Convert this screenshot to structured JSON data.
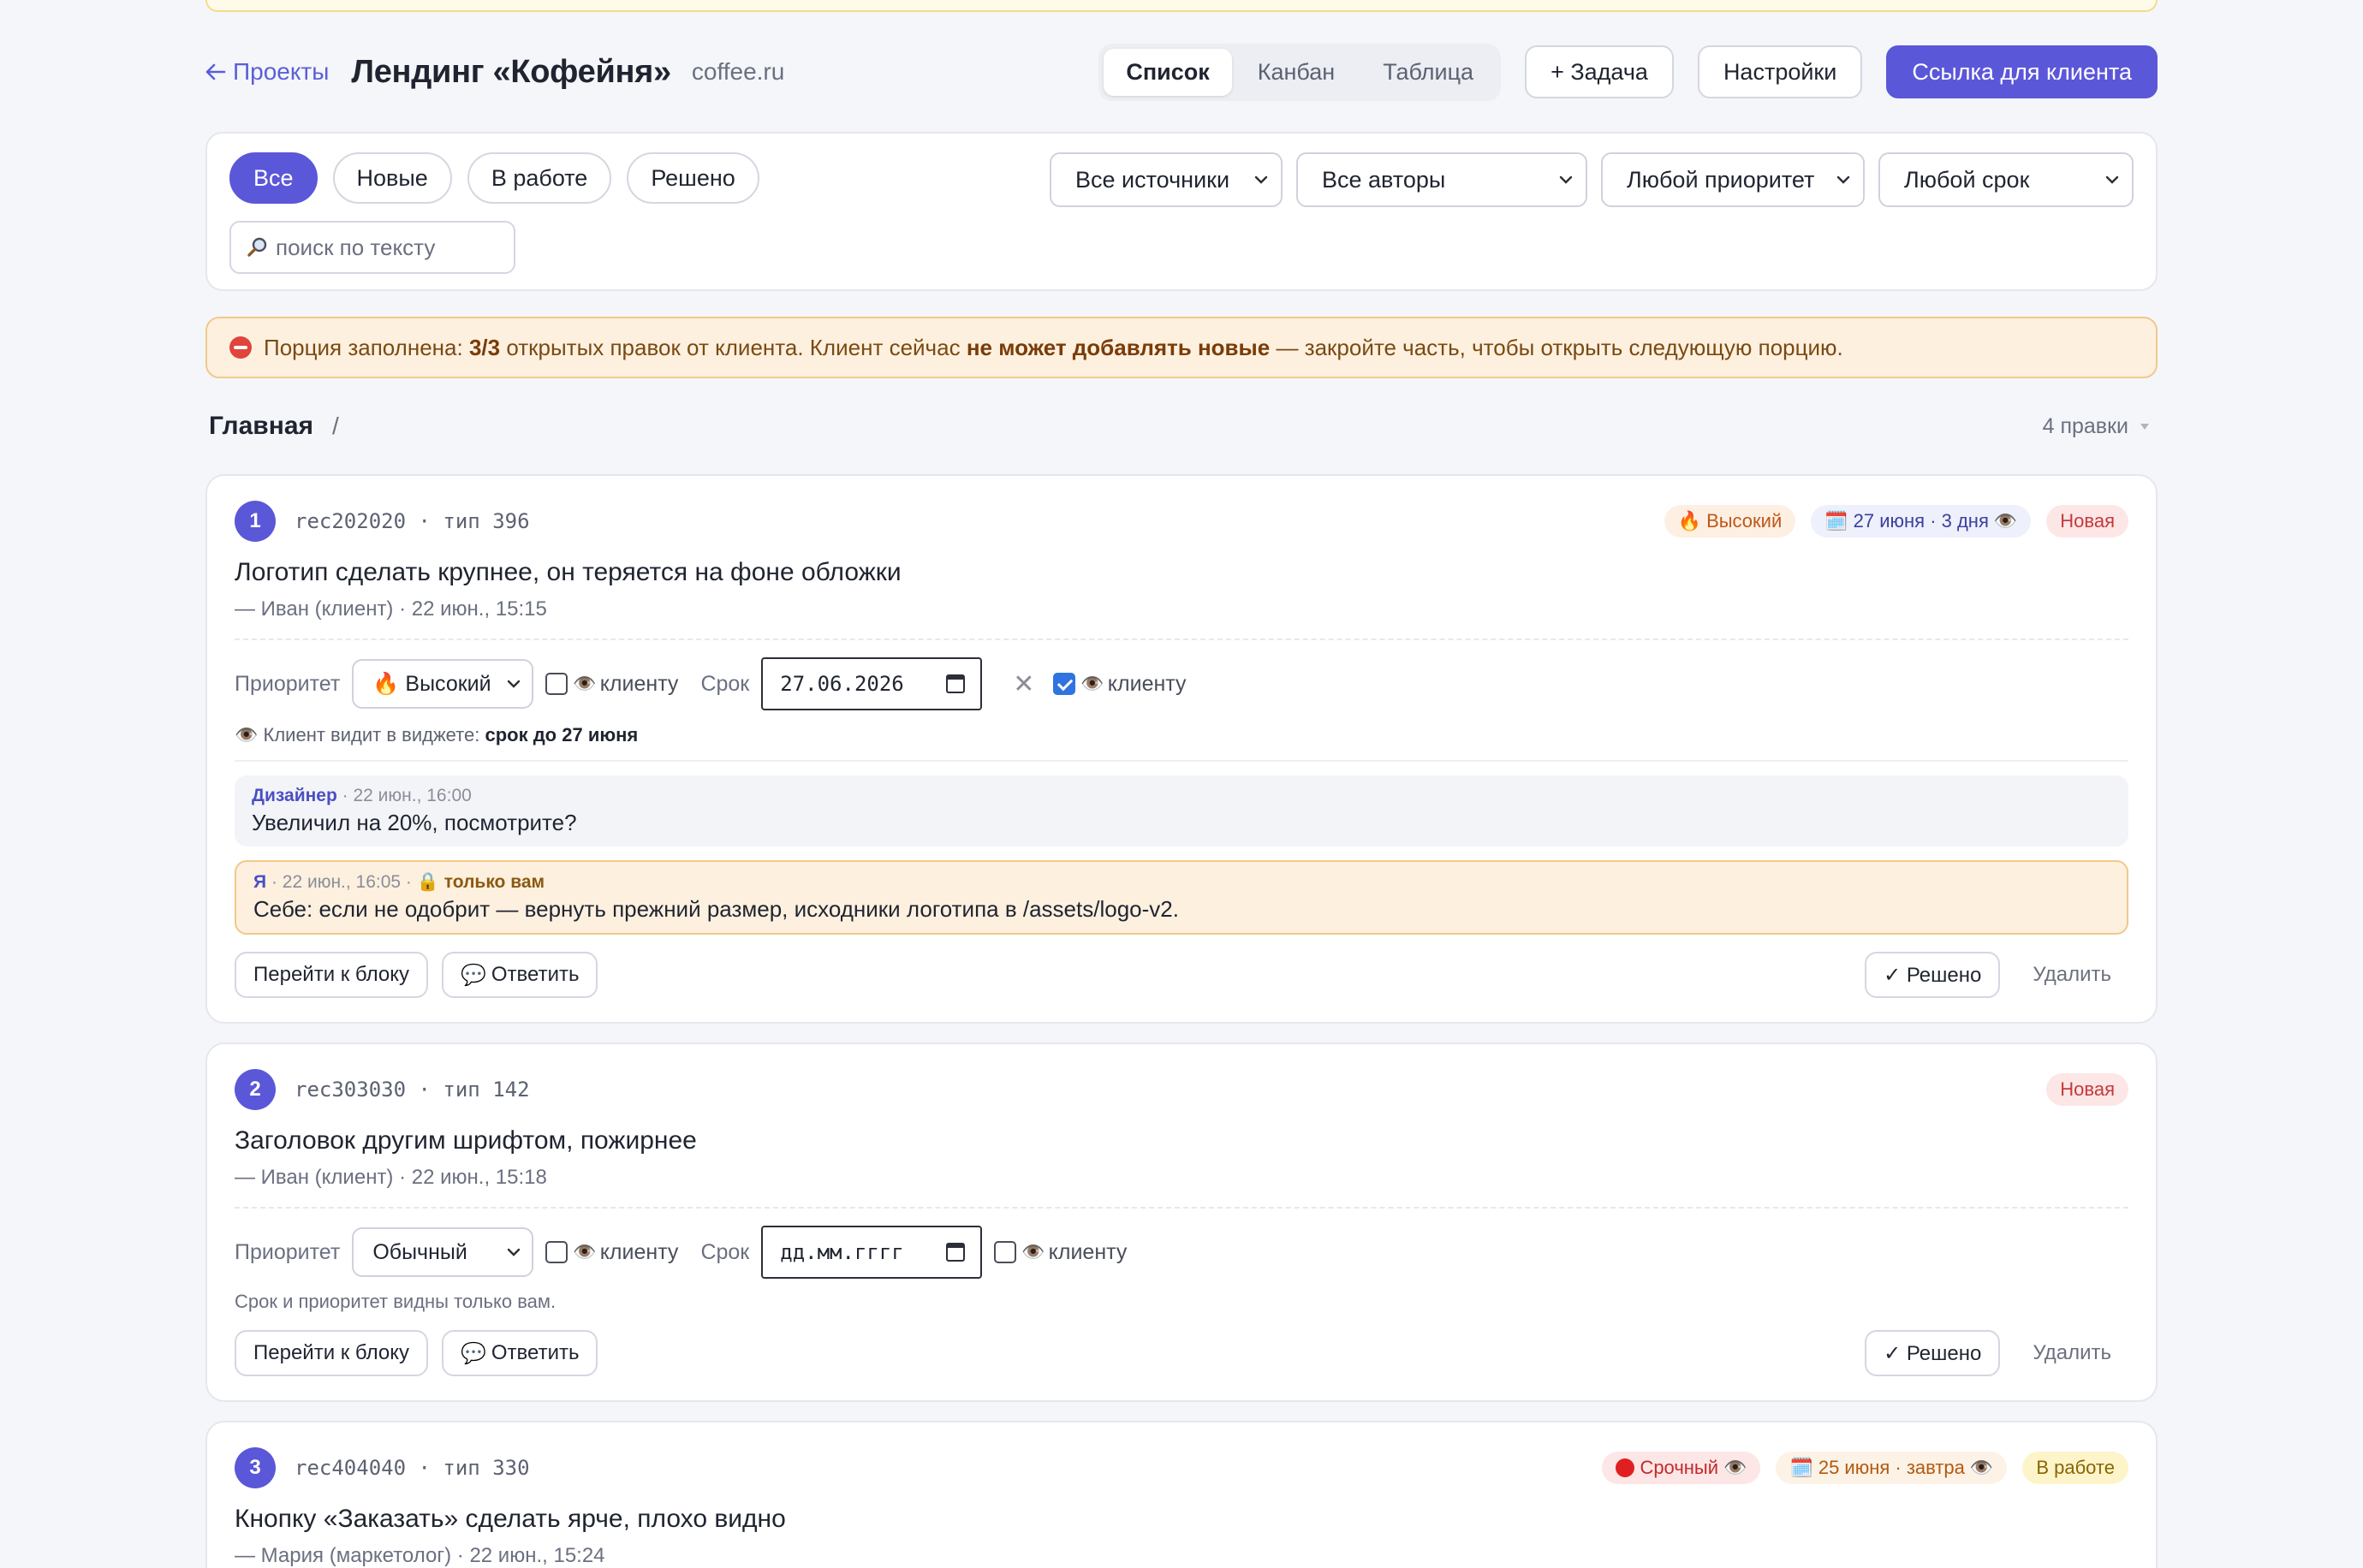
{
  "header": {
    "back_label": "Проекты",
    "title": "Лендинг «Кофейня»",
    "domain": "coffee.ru",
    "views": [
      "Список",
      "Канбан",
      "Таблица"
    ],
    "active_view": 0,
    "add_task_label": "+ Задача",
    "settings_label": "Настройки",
    "client_link_label": "Ссылка для клиента"
  },
  "filters": {
    "chips": [
      "Все",
      "Новые",
      "В работе",
      "Решено"
    ],
    "active_chip": 0,
    "source": "Все источники",
    "author": "Все авторы",
    "priority": "Любой приоритет",
    "deadline": "Любой срок",
    "search_placeholder": "поиск по тексту"
  },
  "warning": {
    "prefix": "Порция заполнена:",
    "count": "3/3",
    "middle": "открытых правок от клиента. Клиент сейчас",
    "emphasis": "не может добавлять новые",
    "suffix": "— закройте часть, чтобы открыть следующую порцию."
  },
  "section": {
    "title": "Главная",
    "slash": "/",
    "count": "4 правки"
  },
  "labels": {
    "priority": "Приоритет",
    "deadline": "Срок",
    "to_client": "клиенту",
    "goto_block": "Перейти к блоку",
    "reply": "Ответить",
    "resolved": "✓ Решено",
    "delete": "Удалить"
  },
  "cards": [
    {
      "num": "1",
      "rec": "rec202020 · тип 396",
      "tag_priority": "Высокий",
      "tag_date": "27 июня · 3 дня",
      "tag_status": "Новая",
      "text": "Логотип сделать крупнее, он теряется на фоне обложки",
      "author": "— Иван (клиент) · 22 июн., 15:15",
      "priority_value": "Высокий",
      "date_value": "27.06.2026",
      "visibility_prefix": "Клиент видит в виджете:",
      "visibility_value": "срок до 27 июня",
      "comments": [
        {
          "author": "Дизайнер",
          "time": "· 22 июн., 16:00",
          "body": "Увеличил на 20%, посмотрите?"
        },
        {
          "author": "Я",
          "time": "· 22 июн., 16:05 ·",
          "private": "только вам",
          "body": "Себе: если не одобрит — вернуть прежний размер, исходники логотипа в /assets/logo-v2."
        }
      ]
    },
    {
      "num": "2",
      "rec": "rec303030 · тип 142",
      "tag_status": "Новая",
      "text": "Заголовок другим шрифтом, пожирнее",
      "author": "— Иван (клиент) · 22 июн., 15:18",
      "priority_value": "Обычный",
      "date_placeholder": "дд.мм.гггг",
      "note": "Срок и приоритет видны только вам."
    },
    {
      "num": "3",
      "rec": "rec404040 · тип 330",
      "tag_priority": "Срочный",
      "tag_date": "25 июня · завтра",
      "tag_status": "В работе",
      "text": "Кнопку «Заказать» сделать ярче, плохо видно",
      "author": "— Мария (маркетолог) · 22 июн., 15:24"
    }
  ]
}
